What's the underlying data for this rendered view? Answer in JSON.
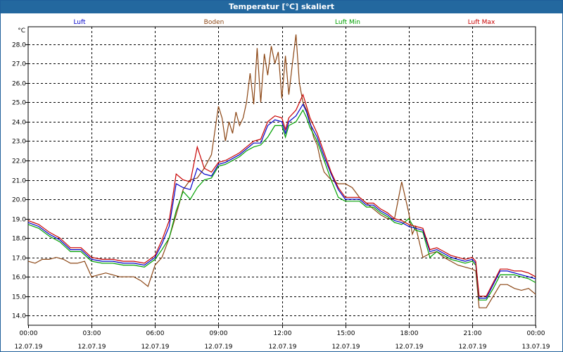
{
  "window": {
    "title": "Temperatur [°C] skaliert"
  },
  "chart_data": {
    "type": "line",
    "unit_label": "°C",
    "ylim": [
      13.5,
      28.9
    ],
    "yticks": [
      14.0,
      15.0,
      16.0,
      17.0,
      18.0,
      19.0,
      20.0,
      21.0,
      22.0,
      23.0,
      24.0,
      25.0,
      26.0,
      27.0,
      28.0
    ],
    "xlim": [
      0,
      24
    ],
    "xticks": [
      {
        "hour": 0,
        "time": "00:00",
        "date": "12.07.19"
      },
      {
        "hour": 3,
        "time": "03:00",
        "date": "12.07.19"
      },
      {
        "hour": 6,
        "time": "06:00",
        "date": "12.07.19"
      },
      {
        "hour": 9,
        "time": "09:00",
        "date": "12.07.19"
      },
      {
        "hour": 12,
        "time": "12:00",
        "date": "12.07.19"
      },
      {
        "hour": 15,
        "time": "15:00",
        "date": "12.07.19"
      },
      {
        "hour": 18,
        "time": "18:00",
        "date": "12.07.19"
      },
      {
        "hour": 21,
        "time": "21:00",
        "date": "12.07.19"
      },
      {
        "hour": 24,
        "time": "00:00",
        "date": "13.07.19"
      }
    ],
    "grid": true,
    "legend_position": "top",
    "series": [
      {
        "name": "Boden",
        "color": "#8b4513",
        "x": [
          0,
          0.33,
          0.67,
          1.0,
          1.33,
          1.67,
          2.0,
          2.33,
          2.67,
          3.0,
          3.33,
          3.67,
          4.0,
          4.33,
          4.67,
          5.0,
          5.33,
          5.67,
          6.0,
          6.33,
          6.67,
          7.0,
          7.33,
          7.67,
          8.0,
          8.33,
          8.67,
          9.0,
          9.17,
          9.33,
          9.5,
          9.67,
          9.83,
          10.0,
          10.17,
          10.33,
          10.5,
          10.67,
          10.83,
          11.0,
          11.17,
          11.33,
          11.5,
          11.67,
          11.83,
          12.0,
          12.17,
          12.33,
          12.5,
          12.67,
          12.83,
          13.0,
          13.17,
          13.33,
          13.5,
          13.67,
          13.83,
          14.0,
          14.33,
          14.67,
          15.0,
          15.33,
          15.67,
          16.0,
          16.33,
          16.67,
          17.0,
          17.33,
          17.67,
          18.0,
          18.17,
          18.33,
          18.67,
          19.0,
          19.33,
          19.67,
          20.0,
          20.33,
          20.67,
          21.0,
          21.17,
          21.33,
          21.67,
          22.0,
          22.33,
          22.67,
          23.0,
          23.33,
          23.67,
          24.0
        ],
        "values": [
          16.8,
          16.7,
          16.9,
          16.9,
          17.0,
          16.9,
          16.7,
          16.7,
          16.8,
          16.0,
          16.1,
          16.2,
          16.1,
          16.0,
          16.0,
          16.0,
          15.8,
          15.5,
          16.6,
          17.0,
          18.0,
          19.2,
          20.5,
          21.0,
          21.1,
          21.6,
          22.3,
          24.8,
          24.2,
          23.0,
          24.0,
          23.4,
          24.5,
          23.8,
          24.2,
          25.0,
          26.5,
          24.9,
          27.8,
          25.0,
          27.5,
          26.4,
          27.9,
          27.0,
          27.6,
          25.2,
          27.4,
          25.4,
          27.0,
          28.5,
          26.0,
          25.0,
          24.6,
          24.0,
          23.2,
          22.8,
          22.0,
          21.4,
          21.0,
          20.8,
          20.8,
          20.6,
          20.1,
          19.8,
          19.5,
          19.2,
          19.0,
          19.0,
          20.9,
          19.3,
          18.2,
          18.6,
          17.0,
          17.2,
          17.3,
          17.0,
          16.8,
          16.6,
          16.5,
          16.4,
          16.3,
          14.4,
          14.4,
          15.0,
          15.6,
          15.6,
          15.4,
          15.3,
          15.4,
          15.1
        ]
      },
      {
        "name": "Luft Min",
        "color": "#00a000",
        "x": [
          0,
          0.5,
          1.0,
          1.5,
          2.0,
          2.5,
          3.0,
          3.5,
          4.0,
          4.5,
          5.0,
          5.5,
          6.0,
          6.33,
          6.67,
          7.0,
          7.33,
          7.67,
          8.0,
          8.33,
          8.67,
          9.0,
          9.33,
          9.67,
          10.0,
          10.33,
          10.67,
          11.0,
          11.33,
          11.67,
          12.0,
          12.17,
          12.33,
          12.67,
          13.0,
          13.17,
          13.33,
          13.67,
          14.0,
          14.33,
          14.67,
          15.0,
          15.33,
          15.67,
          16.0,
          16.33,
          16.67,
          17.0,
          17.33,
          17.67,
          18.0,
          18.33,
          18.67,
          19.0,
          19.33,
          19.67,
          20.0,
          20.33,
          20.67,
          21.0,
          21.17,
          21.33,
          21.67,
          22.0,
          22.33,
          22.67,
          23.0,
          23.33,
          23.67,
          24.0
        ],
        "values": [
          18.7,
          18.5,
          18.1,
          17.8,
          17.3,
          17.3,
          16.8,
          16.7,
          16.7,
          16.6,
          16.6,
          16.5,
          16.9,
          17.4,
          18.0,
          19.4,
          20.4,
          20.0,
          20.6,
          21.0,
          21.1,
          21.7,
          21.8,
          22.0,
          22.2,
          22.5,
          22.7,
          22.8,
          23.2,
          23.8,
          23.8,
          23.2,
          23.8,
          24.0,
          24.6,
          24.2,
          23.7,
          23.0,
          22.0,
          21.0,
          20.1,
          19.9,
          19.9,
          19.9,
          19.6,
          19.6,
          19.3,
          19.1,
          18.8,
          18.7,
          19.0,
          18.4,
          18.3,
          17.0,
          17.3,
          17.1,
          16.9,
          16.8,
          16.7,
          16.8,
          16.6,
          14.8,
          14.8,
          15.4,
          16.1,
          16.1,
          16.1,
          16.0,
          15.9,
          15.7
        ]
      },
      {
        "name": "Luft",
        "color": "#0000c8",
        "x": [
          0,
          0.5,
          1.0,
          1.5,
          2.0,
          2.5,
          3.0,
          3.5,
          4.0,
          4.5,
          5.0,
          5.5,
          6.0,
          6.33,
          6.67,
          7.0,
          7.33,
          7.67,
          8.0,
          8.33,
          8.67,
          9.0,
          9.33,
          9.67,
          10.0,
          10.33,
          10.67,
          11.0,
          11.33,
          11.67,
          12.0,
          12.17,
          12.33,
          12.67,
          13.0,
          13.17,
          13.33,
          13.67,
          14.0,
          14.33,
          14.67,
          15.0,
          15.33,
          15.67,
          16.0,
          16.33,
          16.67,
          17.0,
          17.33,
          17.67,
          18.0,
          18.33,
          18.67,
          19.0,
          19.33,
          19.67,
          20.0,
          20.33,
          20.67,
          21.0,
          21.17,
          21.33,
          21.67,
          22.0,
          22.33,
          22.67,
          23.0,
          23.33,
          23.67,
          24.0
        ],
        "values": [
          18.8,
          18.6,
          18.2,
          17.9,
          17.4,
          17.4,
          16.9,
          16.8,
          16.8,
          16.7,
          16.7,
          16.6,
          17.0,
          17.7,
          18.6,
          20.8,
          20.6,
          20.5,
          21.6,
          21.3,
          21.2,
          21.8,
          21.9,
          22.1,
          22.3,
          22.6,
          22.9,
          22.9,
          23.8,
          24.1,
          24.0,
          23.4,
          24.0,
          24.3,
          24.9,
          24.5,
          23.9,
          23.2,
          22.2,
          21.3,
          20.5,
          20.0,
          20.0,
          20.0,
          19.7,
          19.7,
          19.4,
          19.2,
          18.9,
          18.8,
          18.6,
          18.5,
          18.4,
          17.3,
          17.4,
          17.2,
          17.0,
          16.9,
          16.8,
          16.9,
          16.7,
          14.9,
          14.9,
          15.6,
          16.3,
          16.3,
          16.2,
          16.1,
          16.0,
          15.9
        ]
      },
      {
        "name": "Luft Max",
        "color": "#c80000",
        "x": [
          0,
          0.5,
          1.0,
          1.5,
          2.0,
          2.5,
          3.0,
          3.5,
          4.0,
          4.5,
          5.0,
          5.5,
          6.0,
          6.33,
          6.67,
          7.0,
          7.33,
          7.67,
          8.0,
          8.33,
          8.67,
          9.0,
          9.33,
          9.67,
          10.0,
          10.33,
          10.67,
          11.0,
          11.33,
          11.67,
          12.0,
          12.17,
          12.33,
          12.67,
          13.0,
          13.17,
          13.33,
          13.67,
          14.0,
          14.33,
          14.67,
          15.0,
          15.33,
          15.67,
          16.0,
          16.33,
          16.67,
          17.0,
          17.33,
          17.67,
          18.0,
          18.33,
          18.67,
          19.0,
          19.33,
          19.67,
          20.0,
          20.33,
          20.67,
          21.0,
          21.17,
          21.33,
          21.67,
          22.0,
          22.33,
          22.67,
          23.0,
          23.33,
          23.67,
          24.0
        ],
        "values": [
          18.9,
          18.7,
          18.3,
          18.0,
          17.5,
          17.5,
          17.0,
          16.9,
          16.9,
          16.8,
          16.8,
          16.7,
          17.1,
          17.9,
          18.9,
          21.3,
          21.0,
          20.9,
          22.7,
          21.6,
          21.4,
          21.9,
          22.0,
          22.2,
          22.4,
          22.7,
          23.0,
          23.1,
          24.0,
          24.3,
          24.2,
          23.6,
          24.2,
          24.6,
          25.4,
          24.8,
          24.2,
          23.4,
          22.4,
          21.4,
          20.6,
          20.1,
          20.1,
          20.1,
          19.8,
          19.8,
          19.5,
          19.3,
          19.0,
          18.9,
          18.7,
          18.6,
          18.5,
          17.4,
          17.5,
          17.3,
          17.1,
          17.0,
          16.9,
          17.0,
          16.8,
          15.0,
          15.0,
          15.7,
          16.4,
          16.4,
          16.3,
          16.3,
          16.2,
          16.0
        ]
      }
    ],
    "legend_order": [
      "Luft",
      "Boden",
      "Luft Min",
      "Luft Max"
    ]
  }
}
